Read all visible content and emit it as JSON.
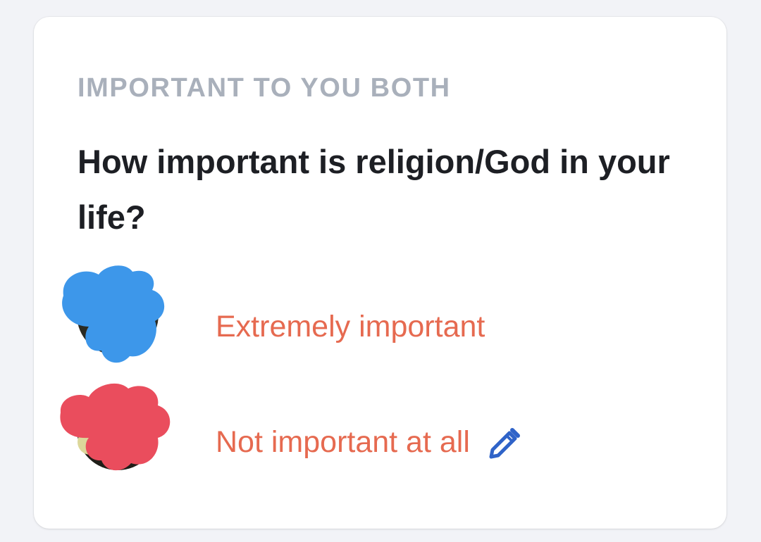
{
  "card": {
    "section_label": "IMPORTANT TO YOU BOTH",
    "question": "How important is religion/God in your life?",
    "answers": [
      {
        "who": "them",
        "text": "Extremely important",
        "avatar_scribble_color": "#3d97ea"
      },
      {
        "who": "you",
        "text": "Not important at all",
        "avatar_scribble_color": "#ea4d5d",
        "edit_icon": "pencil-icon",
        "edit_icon_color": "#2f63c8"
      }
    ]
  },
  "colors": {
    "background": "#f2f3f7",
    "card": "#ffffff",
    "label": "#a9b0bb",
    "question": "#1d1f24",
    "answer": "#e66a50"
  }
}
